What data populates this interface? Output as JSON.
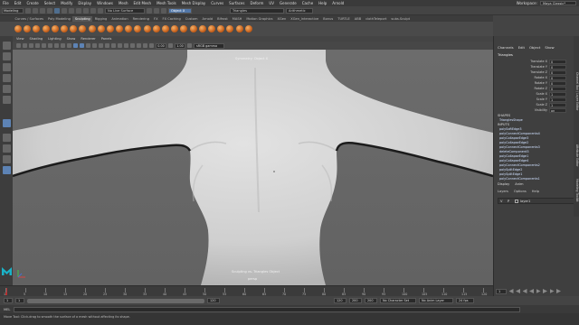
{
  "menubar": {
    "items": [
      "File",
      "Edit",
      "Create",
      "Select",
      "Modify",
      "Display",
      "Windows",
      "Mesh",
      "Edit Mesh",
      "Mesh Tools",
      "Mesh Display",
      "Curves",
      "Surfaces",
      "Deform",
      "UV",
      "Generate",
      "Cache",
      "Help",
      "Arnold"
    ],
    "workspace_label": "Workspace:",
    "workspace_value": "Maya Classic*"
  },
  "statusline": {
    "mode": "Modeling",
    "live_surface": "No Live Surface",
    "symmetry": "Object X",
    "symmetry_type": "Triangles",
    "render_field": "Arithmetic"
  },
  "shelf": {
    "tabs": [
      "Curves / Surfaces",
      "Poly Modeling",
      "Sculpting",
      "Rigging",
      "Animation",
      "Rendering",
      "FX",
      "FX Caching",
      "Custom",
      "Arnold",
      "Bifrost",
      "MASH",
      "Motion Graphics",
      "XGen",
      "XGen_Interactive",
      "Bonus",
      "TURTLE",
      "ABB",
      "clothTeleport",
      "subs.Sculpt"
    ],
    "active_tab": "Sculpting",
    "tool_count": 26
  },
  "panel": {
    "menus": [
      "View",
      "Shading",
      "Lighting",
      "Show",
      "Renderer",
      "Panels"
    ],
    "field_a": "0.00",
    "field_b": "1.00",
    "color_space": "sRGB gamma"
  },
  "viewport": {
    "top_label": "Symmetry: Object X",
    "bottom_label": "Sculpting vs. Triangles Object",
    "bottom_sub": "persp"
  },
  "channel_box": {
    "menus": [
      "Channels",
      "Edit",
      "Object",
      "Show"
    ],
    "object_name": "Triangles",
    "attributes": [
      {
        "label": "Translate X",
        "value": "0"
      },
      {
        "label": "Translate Y",
        "value": "0"
      },
      {
        "label": "Translate Z",
        "value": "0"
      },
      {
        "label": "Rotate X",
        "value": "0"
      },
      {
        "label": "Rotate Y",
        "value": "0"
      },
      {
        "label": "Rotate Z",
        "value": "0"
      },
      {
        "label": "Scale X",
        "value": "1"
      },
      {
        "label": "Scale Y",
        "value": "1"
      },
      {
        "label": "Scale Z",
        "value": "1"
      },
      {
        "label": "Visibility",
        "value": "on"
      }
    ],
    "shapes_header": "SHAPES",
    "shape_name": "TrianglesShape",
    "inputs_header": "INPUTS",
    "inputs": [
      "polySoftEdge3",
      "polyConnectComponents4",
      "polyCollapseEdge3",
      "polyCollapseEdge2",
      "polyConnectComponents3",
      "deleteComponent3",
      "polyCollapseEdge1",
      "polyCollapseEdge4",
      "polyConnectComponents2",
      "polySplitEdge2",
      "polySplitEdge1",
      "polyConnectComponents1"
    ]
  },
  "side_tabs": [
    "Channel Box / Layer Editor",
    "Attribute Editor",
    "Modeling Toolkit"
  ],
  "layers": {
    "tabs": [
      "Display",
      "Anim"
    ],
    "menus": [
      "Layers",
      "Options",
      "Help"
    ],
    "rows": [
      {
        "vis": "V",
        "play": "P",
        "name": "layer1"
      }
    ]
  },
  "timeslider": {
    "ticks": [
      "1",
      "5",
      "10",
      "15",
      "20",
      "25",
      "30",
      "35",
      "40",
      "45",
      "50",
      "55",
      "60",
      "65",
      "70",
      "75",
      "80",
      "85",
      "90",
      "95",
      "100",
      "105",
      "110",
      "115",
      "120"
    ]
  },
  "playback": {
    "current_frame": "1"
  },
  "range": {
    "start": "1",
    "inner_start": "1",
    "range_value": "120",
    "inner_end": "120",
    "end": "200",
    "end_outer": "200",
    "char_set": "No Character Set",
    "anim_layer": "No Anim Layer",
    "fps": "24 fps"
  },
  "cmdline": {
    "label": "MEL"
  },
  "helpline": {
    "text": "Move Tool: Click-drag to smooth the surface of a mesh without affecting its shape."
  },
  "colors": {
    "accent_blue": "#5277a8",
    "maya_logo": "#1ab3c8",
    "shelf_orange": "#e07a2a"
  }
}
